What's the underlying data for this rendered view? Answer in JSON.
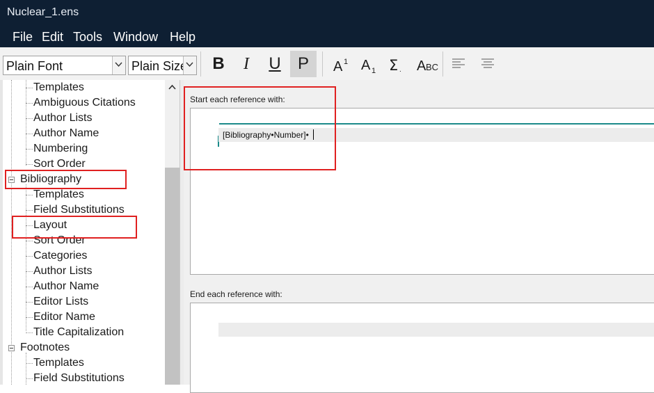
{
  "window": {
    "title": "Nuclear_1.ens"
  },
  "menu": [
    "File",
    "Edit",
    "Tools",
    "Window",
    "Help"
  ],
  "toolbar": {
    "font_value": "Plain Font",
    "size_value": "Plain Size",
    "bold": "B",
    "italic": "I",
    "underline": "U",
    "plain": "P"
  },
  "tree": {
    "top_children": [
      "Templates",
      "Ambiguous Citations",
      "Author Lists",
      "Author Name",
      "Numbering",
      "Sort Order"
    ],
    "bibliography": {
      "label": "Bibliography",
      "children": [
        "Templates",
        "Field Substitutions",
        "Layout",
        "Sort Order",
        "Categories",
        "Author Lists",
        "Author Name",
        "Editor Lists",
        "Editor Name",
        "Title Capitalization"
      ]
    },
    "footnotes": {
      "label": "Footnotes",
      "children": [
        "Templates",
        "Field Substitutions"
      ]
    }
  },
  "layout_panel": {
    "start_label": "Start each reference with:",
    "start_value": "[Bibliography•Number]•",
    "end_label": "End each reference with:",
    "end_value": ""
  },
  "colors": {
    "titlebar": "#0e1f33",
    "highlight": "#e02020",
    "caret_line": "#1b8a8a"
  }
}
